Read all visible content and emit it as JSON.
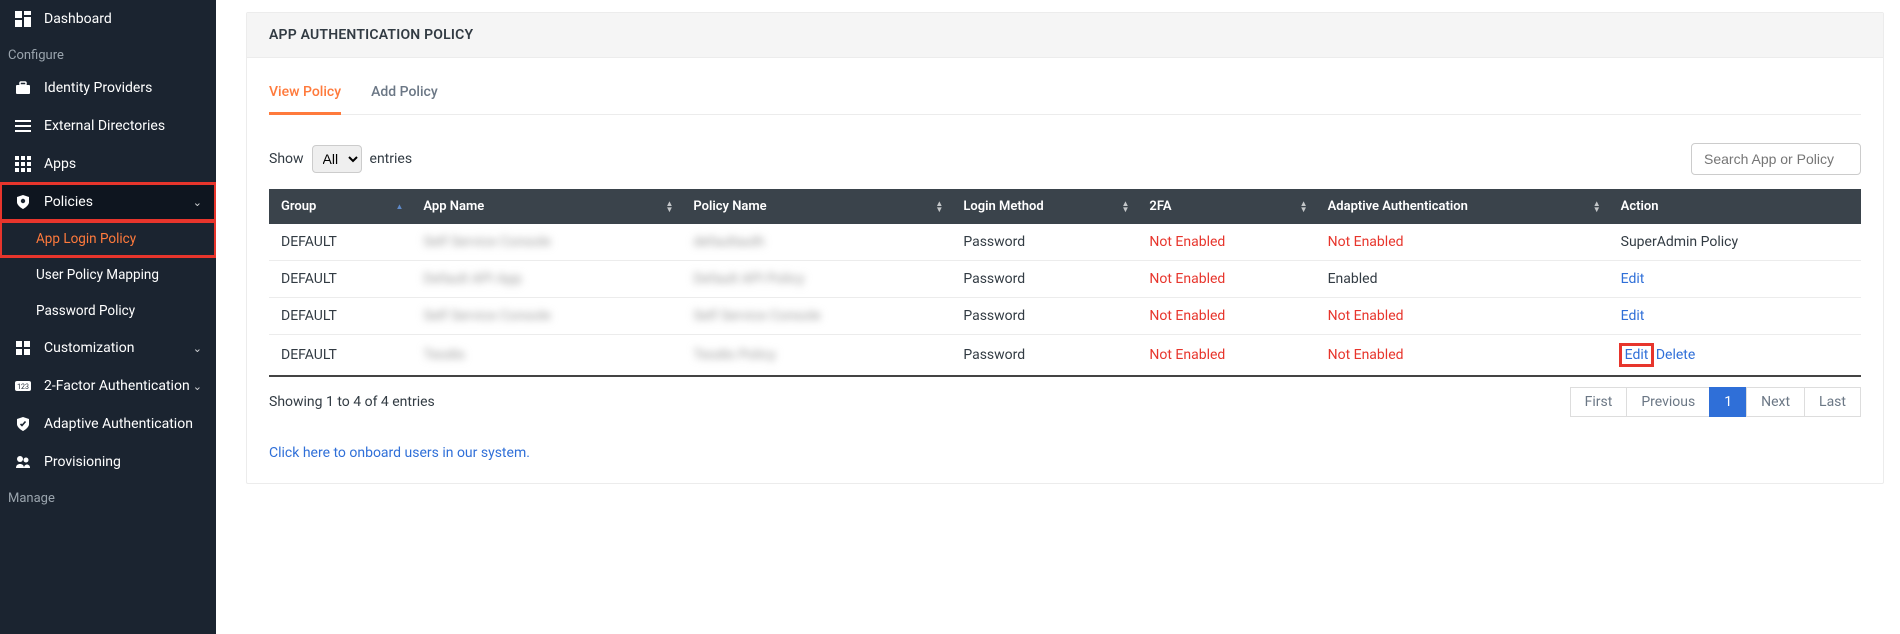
{
  "sidebar": {
    "items": [
      {
        "label": "Dashboard"
      }
    ],
    "section_configure": "Configure",
    "configure_items": [
      {
        "label": "Identity Providers"
      },
      {
        "label": "External Directories"
      },
      {
        "label": "Apps"
      },
      {
        "label": "Policies"
      }
    ],
    "policies_sub": [
      {
        "label": "App Login Policy"
      },
      {
        "label": "User Policy Mapping"
      },
      {
        "label": "Password Policy"
      }
    ],
    "after_items": [
      {
        "label": "Customization"
      },
      {
        "label": "2-Factor Authentication"
      },
      {
        "label": "Adaptive Authentication"
      },
      {
        "label": "Provisioning"
      }
    ],
    "section_manage": "Manage"
  },
  "page": {
    "card_title": "APP AUTHENTICATION POLICY",
    "tabs": [
      {
        "label": "View Policy",
        "active": true
      },
      {
        "label": "Add Policy",
        "active": false
      }
    ],
    "entries_label_pre": "Show",
    "entries_label_post": "entries",
    "entries_options": [
      "All"
    ],
    "entries_selected": "All",
    "search_placeholder": "Search App or Policy",
    "columns": [
      "Group",
      "App Name",
      "Policy Name",
      "Login Method",
      "2FA",
      "Adaptive Authentication",
      "Action"
    ],
    "rows": [
      {
        "group": "DEFAULT",
        "app": "Self Service Console",
        "policy": "defaultauth",
        "login": "Password",
        "twofa": "Not Enabled",
        "adaptive": "Not Enabled",
        "action_type": "super",
        "action_label": "SuperAdmin Policy"
      },
      {
        "group": "DEFAULT",
        "app": "Default API App",
        "policy": "Default API Policy",
        "login": "Password",
        "twofa": "Not Enabled",
        "adaptive": "Enabled",
        "action_type": "edit",
        "action_label": "Edit"
      },
      {
        "group": "DEFAULT",
        "app": "Self Service Console",
        "policy": "Self Service Console",
        "login": "Password",
        "twofa": "Not Enabled",
        "adaptive": "Not Enabled",
        "action_type": "edit",
        "action_label": "Edit"
      },
      {
        "group": "DEFAULT",
        "app": "Teodis",
        "policy": "Teodis Policy",
        "login": "Password",
        "twofa": "Not Enabled",
        "adaptive": "Not Enabled",
        "action_type": "editdelete",
        "action_label": "Edit",
        "delete_label": "Delete"
      }
    ],
    "footer_info": "Showing 1 to 4 of 4 entries",
    "pagination": {
      "first": "First",
      "previous": "Previous",
      "pages": [
        "1"
      ],
      "next": "Next",
      "last": "Last",
      "active": "1"
    },
    "onboard_link": "Click here to onboard users in our system."
  }
}
